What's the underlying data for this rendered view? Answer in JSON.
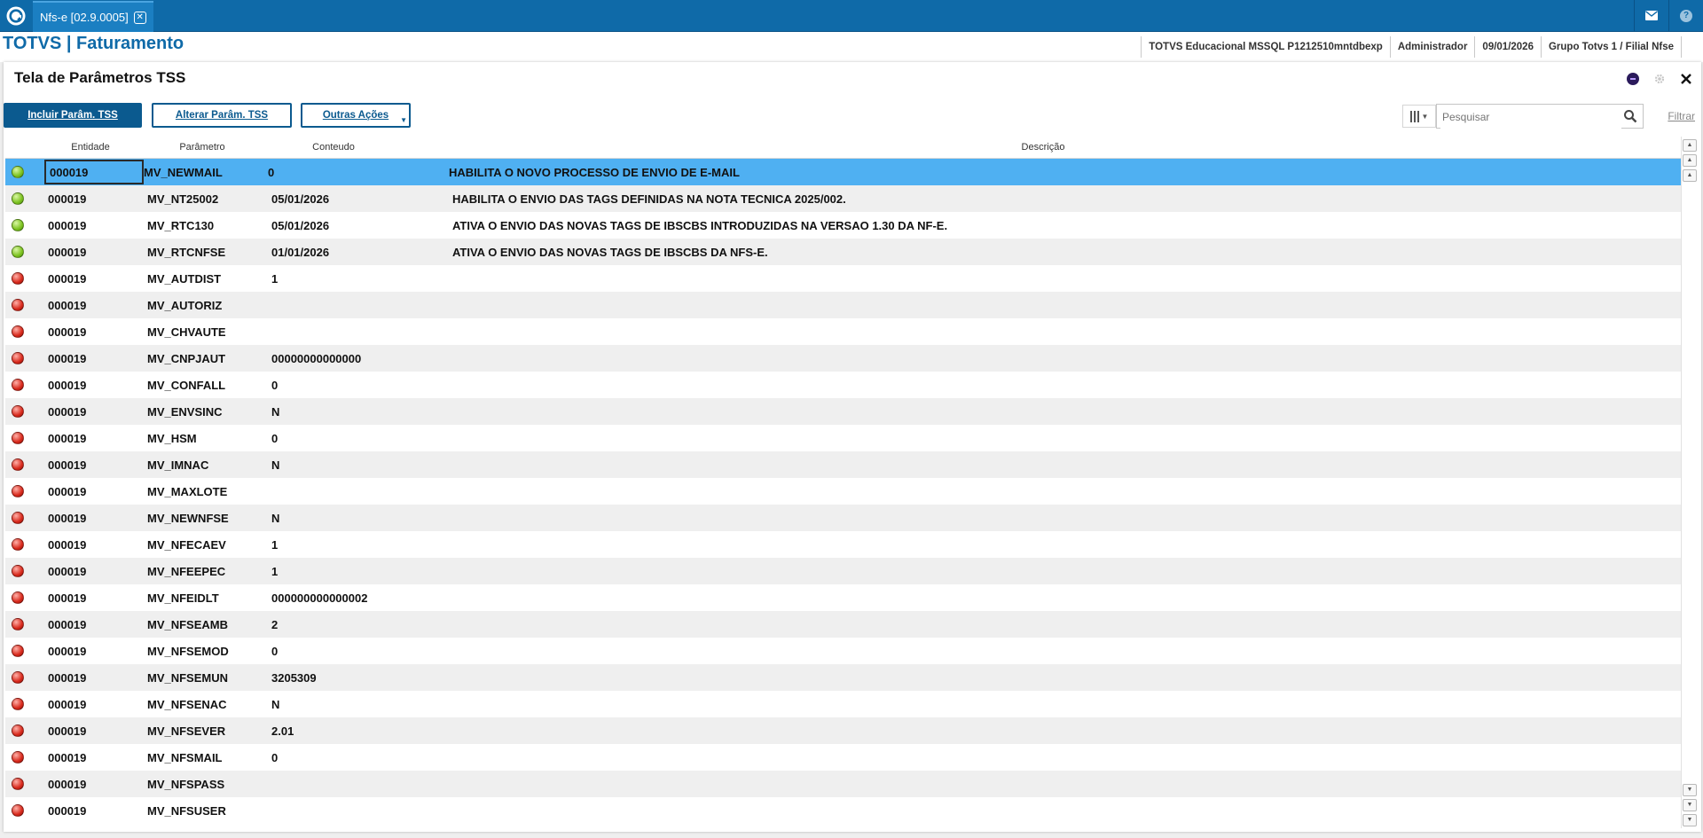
{
  "topbar": {
    "tab_label": "Nfs-e [02.9.0005]",
    "tab_close": "✕",
    "icons": [
      "totvs-logo-icon",
      "mail-icon",
      "help-icon"
    ],
    "help_label": "?"
  },
  "header": {
    "module_title": "TOTVS | Faturamento",
    "environment": "TOTVS Educacional MSSQL P1212510mntdbexp",
    "user": "Administrador",
    "date": "09/01/2026",
    "company": "Grupo Totvs 1 / Filial Nfse"
  },
  "panel": {
    "title": "Tela de Parâmetros TSS",
    "buttons": {
      "include": "Incluir Parâm. TSS",
      "alter": "Alterar Parâm. TSS",
      "other": "Outras Ações"
    },
    "search": {
      "placeholder": "Pesquisar"
    },
    "filter_label": "Filtrar"
  },
  "grid": {
    "columns": [
      "Entidade",
      "Parâmetro",
      "Conteudo",
      "Descrição"
    ],
    "rows": [
      {
        "status": "green",
        "entidade": "000019",
        "parametro": "MV_NEWMAIL",
        "conteudo": "0",
        "descricao": "HABILITA O NOVO PROCESSO DE ENVIO DE E-MAIL"
      },
      {
        "status": "green",
        "entidade": "000019",
        "parametro": "MV_NT25002",
        "conteudo": "05/01/2026",
        "descricao": "HABILITA O ENVIO DAS TAGS DEFINIDAS NA NOTA TECNICA 2025/002."
      },
      {
        "status": "green",
        "entidade": "000019",
        "parametro": "MV_RTC130",
        "conteudo": "05/01/2026",
        "descricao": "ATIVA O ENVIO DAS NOVAS TAGS DE IBSCBS INTRODUZIDAS NA VERSAO 1.30 DA NF-E."
      },
      {
        "status": "green",
        "entidade": "000019",
        "parametro": "MV_RTCNFSE",
        "conteudo": "01/01/2026",
        "descricao": "ATIVA O ENVIO DAS NOVAS TAGS DE IBSCBS DA NFS-E."
      },
      {
        "status": "red",
        "entidade": "000019",
        "parametro": "MV_AUTDIST",
        "conteudo": "1",
        "descricao": ""
      },
      {
        "status": "red",
        "entidade": "000019",
        "parametro": "MV_AUTORIZ",
        "conteudo": "",
        "descricao": ""
      },
      {
        "status": "red",
        "entidade": "000019",
        "parametro": "MV_CHVAUTE",
        "conteudo": "",
        "descricao": ""
      },
      {
        "status": "red",
        "entidade": "000019",
        "parametro": "MV_CNPJAUT",
        "conteudo": "00000000000000",
        "descricao": ""
      },
      {
        "status": "red",
        "entidade": "000019",
        "parametro": "MV_CONFALL",
        "conteudo": "0",
        "descricao": ""
      },
      {
        "status": "red",
        "entidade": "000019",
        "parametro": "MV_ENVSINC",
        "conteudo": "N",
        "descricao": ""
      },
      {
        "status": "red",
        "entidade": "000019",
        "parametro": "MV_HSM",
        "conteudo": "0",
        "descricao": ""
      },
      {
        "status": "red",
        "entidade": "000019",
        "parametro": "MV_IMNAC",
        "conteudo": "N",
        "descricao": ""
      },
      {
        "status": "red",
        "entidade": "000019",
        "parametro": "MV_MAXLOTE",
        "conteudo": "",
        "descricao": ""
      },
      {
        "status": "red",
        "entidade": "000019",
        "parametro": "MV_NEWNFSE",
        "conteudo": "N",
        "descricao": ""
      },
      {
        "status": "red",
        "entidade": "000019",
        "parametro": "MV_NFECAEV",
        "conteudo": "1",
        "descricao": ""
      },
      {
        "status": "red",
        "entidade": "000019",
        "parametro": "MV_NFEEPEC",
        "conteudo": "1",
        "descricao": ""
      },
      {
        "status": "red",
        "entidade": "000019",
        "parametro": "MV_NFEIDLT",
        "conteudo": "000000000000002",
        "descricao": ""
      },
      {
        "status": "red",
        "entidade": "000019",
        "parametro": "MV_NFSEAMB",
        "conteudo": "2",
        "descricao": ""
      },
      {
        "status": "red",
        "entidade": "000019",
        "parametro": "MV_NFSEMOD",
        "conteudo": "0",
        "descricao": ""
      },
      {
        "status": "red",
        "entidade": "000019",
        "parametro": "MV_NFSEMUN",
        "conteudo": "3205309",
        "descricao": ""
      },
      {
        "status": "red",
        "entidade": "000019",
        "parametro": "MV_NFSENAC",
        "conteudo": "N",
        "descricao": ""
      },
      {
        "status": "red",
        "entidade": "000019",
        "parametro": "MV_NFSEVER",
        "conteudo": "2.01",
        "descricao": ""
      },
      {
        "status": "red",
        "entidade": "000019",
        "parametro": "MV_NFSMAIL",
        "conteudo": "0",
        "descricao": ""
      },
      {
        "status": "red",
        "entidade": "000019",
        "parametro": "MV_NFSPASS",
        "conteudo": "",
        "descricao": ""
      },
      {
        "status": "red",
        "entidade": "000019",
        "parametro": "MV_NFSUSER",
        "conteudo": "",
        "descricao": ""
      }
    ]
  },
  "colors": {
    "brand_blue": "#0f6aa8",
    "selected_row": "#4fb0f2",
    "status_green": "#7cc21f",
    "status_red": "#d8291c"
  }
}
